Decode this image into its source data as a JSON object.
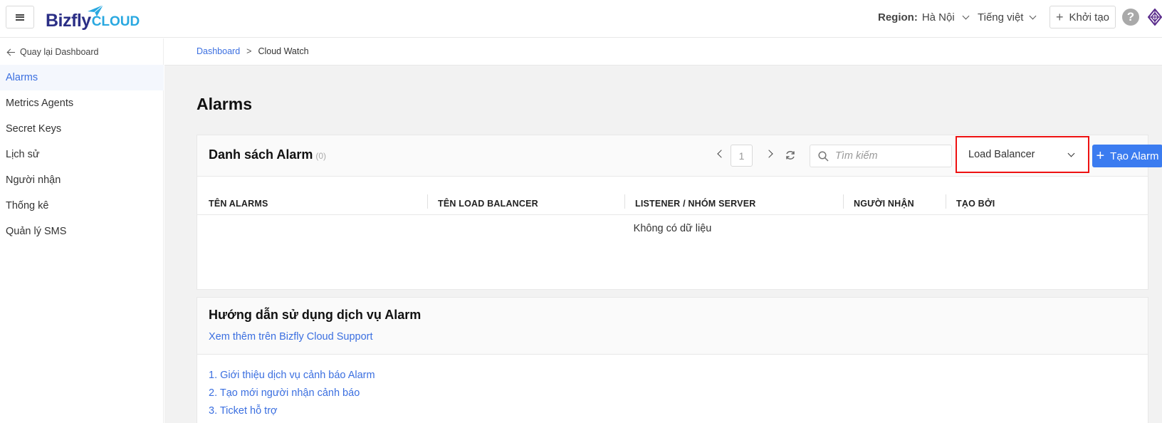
{
  "header": {
    "logo_main": "Bizfly",
    "logo_sub": "CLOUD",
    "region_label": "Region:",
    "region_value": "Hà Nội",
    "language": "Tiếng việt",
    "create_label": "Khởi tạo",
    "help_glyph": "?"
  },
  "sidebar": {
    "back_label": "Quay lại Dashboard",
    "items": [
      {
        "label": "Alarms",
        "active": true
      },
      {
        "label": "Metrics Agents"
      },
      {
        "label": "Secret Keys"
      },
      {
        "label": "Lịch sử"
      },
      {
        "label": "Người nhận"
      },
      {
        "label": "Thống kê"
      },
      {
        "label": "Quản lý SMS"
      }
    ]
  },
  "breadcrumb": {
    "root": "Dashboard",
    "separator": ">",
    "current": "Cloud Watch"
  },
  "page": {
    "title": "Alarms"
  },
  "alarm_panel": {
    "title": "Danh sách Alarm",
    "count": "(0)",
    "current_page": "1",
    "search_placeholder": "Tìm kiếm",
    "selected_type": "Load Balancer",
    "create_button": "Tạo Alarm",
    "columns": [
      "TÊN ALARMS",
      "TÊN LOAD BALANCER",
      "LISTENER / NHÓM SERVER",
      "NGƯỜI NHẬN",
      "TẠO BỞI"
    ],
    "empty_text": "Không có dữ liệu"
  },
  "guide": {
    "title": "Hướng dẫn sử dụng dịch vụ Alarm",
    "support_link": "Xem thêm trên Bizfly Cloud Support",
    "links": [
      "1. Giới thiệu dịch vụ cảnh báo Alarm",
      "2. Tạo mới người nhận cảnh báo",
      "3. Ticket hỗ trợ"
    ]
  },
  "colors": {
    "accent": "#3b7cf0",
    "link": "#3b6fe0",
    "highlight_border": "#ee1111",
    "brand_dark": "#2b2f86",
    "brand_light": "#29a8e0"
  },
  "icons": [
    "menu-icon",
    "paper-plane-icon",
    "chevron-down-icon",
    "plus-icon",
    "help-icon",
    "apps-icon",
    "arrow-left-icon",
    "chevron-left-icon",
    "chevron-right-icon",
    "refresh-icon",
    "search-icon"
  ]
}
